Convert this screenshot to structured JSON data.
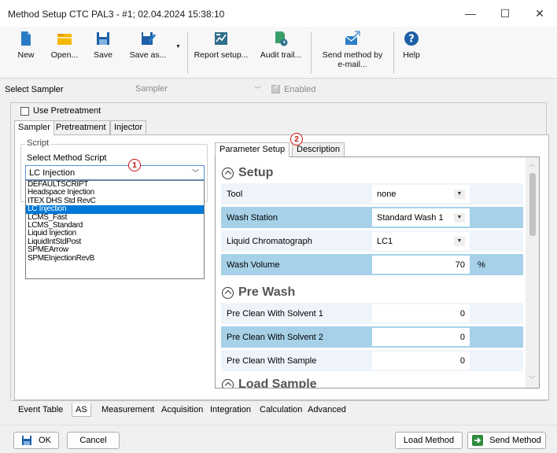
{
  "window": {
    "title": "Method Setup CTC PAL3 - #1;  02.04.2024  15:38:10",
    "controls": {
      "minimize": "—",
      "maximize": "☐",
      "close": "✕"
    }
  },
  "toolbar": {
    "new": "New",
    "open": "Open...",
    "save": "Save",
    "save_as": "Save as...",
    "report_setup": "Report setup...",
    "audit_trail": "Audit trail...",
    "send_method_line1": "Send method by",
    "send_method_line2": "e-mail...",
    "help": "Help"
  },
  "sampler_row": {
    "label": "Select Sampler",
    "value": "Sampler",
    "enabled_label": "Enabled"
  },
  "use_pretreatment": "Use Pretreatment",
  "tabs": [
    "Sampler",
    "Pretreatment",
    "Injector"
  ],
  "script": {
    "group_label": "Script",
    "select_label": "Select Method Script",
    "selected": "LC Injection",
    "options": [
      "DEFAULTSCRIPT",
      "Headspace Injection",
      "ITEX DHS Std RevC",
      "LC Injection",
      "LCMS_Fast",
      "LCMS_Standard",
      "Liquid Injection",
      "LiquidIntStdPost",
      "SPMEArrow",
      "SPMEInjectionRevB"
    ]
  },
  "badges": {
    "one": "1",
    "two": "2"
  },
  "param_tabs": [
    "Parameter Setup",
    "Description"
  ],
  "sections": {
    "setup": "Setup",
    "pre_wash": "Pre Wash",
    "load_sample": "Load Sample"
  },
  "params": [
    {
      "label": "Tool",
      "value": "none",
      "kind": "dropdown"
    },
    {
      "label": "Wash Station",
      "value": "Standard Wash 1",
      "kind": "dropdown"
    },
    {
      "label": "Liquid Chromatograph",
      "value": "LC1",
      "kind": "dropdown"
    },
    {
      "label": "Wash Volume",
      "value": "70",
      "unit": "%",
      "kind": "number"
    },
    {
      "label": "Pre Clean With Solvent 1",
      "value": "0",
      "kind": "number"
    },
    {
      "label": "Pre Clean With Solvent 2",
      "value": "0",
      "kind": "number"
    },
    {
      "label": "Pre Clean With Sample",
      "value": "0",
      "kind": "number"
    }
  ],
  "bottom_tabs": [
    "Event Table",
    "AS",
    "Measurement",
    "Acquisition",
    "Integration",
    "Calculation",
    "Advanced"
  ],
  "footer": {
    "ok": "OK",
    "cancel": "Cancel",
    "load_method": "Load Method",
    "send_method": "Send Method"
  },
  "colors": {
    "accent_blue": "#1e6fbf",
    "selected_blue": "#0078d7",
    "row_highlight": "#a6d1e8",
    "badge_red": "#cc1111"
  }
}
